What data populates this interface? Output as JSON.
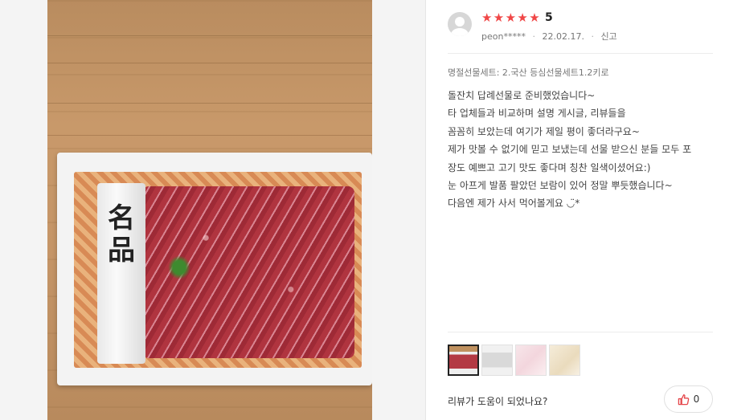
{
  "review": {
    "rating_score": "5",
    "stars": [
      "★",
      "★",
      "★",
      "★",
      "★"
    ],
    "user": "peon*****",
    "date": "22.02.17.",
    "report_label": "신고",
    "option_text": "명절선물세트: 2.국산 등심선물세트1.2키로",
    "body_lines": [
      "돌잔치 답례선물로 준비했었습니다~",
      "타 업체들과 비교하며 설명 게시글, 리뷰들을",
      "꼼꼼히 보았는데 여기가 제일 평이 좋더라구요~",
      "제가 맛볼 수 없기에 믿고 보냈는데 선물 받으신 분들 모두 포",
      "장도 예쁘고 고기 맛도 좋다며 칭찬 일색이셨어요:)",
      "눈 아프게 발품 팔았던 보람이 있어 정말 뿌듯했습니다~",
      "다음엔 제가 사서 먹어볼게요 ◡̈*"
    ]
  },
  "photo": {
    "label_chars": [
      "名",
      "品"
    ]
  },
  "thumbnails": [
    "thumbnail-1",
    "thumbnail-2",
    "thumbnail-3",
    "thumbnail-4"
  ],
  "helpful": {
    "question": "리뷰가 도움이 되었나요?",
    "count": "0"
  },
  "colors": {
    "star": "#f04646",
    "like_icon": "#e5464a"
  },
  "icons": {
    "avatar": "user-avatar-icon",
    "like": "thumbs-up-icon"
  }
}
